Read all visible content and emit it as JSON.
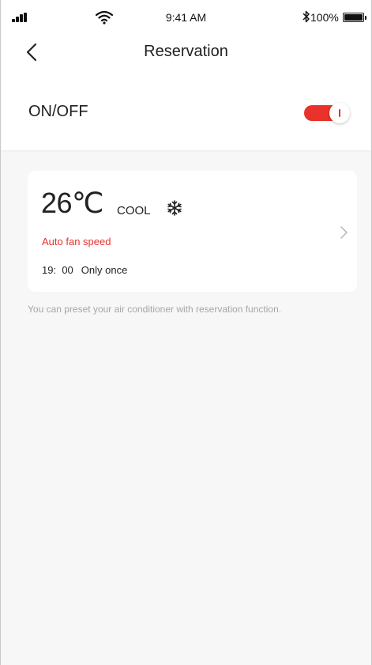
{
  "status_bar": {
    "time": "9:41 AM",
    "battery": "100%",
    "icons": [
      "signal-icon",
      "wifi-icon",
      "bluetooth-icon",
      "battery-icon"
    ]
  },
  "nav": {
    "title": "Reservation",
    "back_icon": "chevron-left-icon"
  },
  "power": {
    "label": "ON/OFF",
    "enabled": true
  },
  "reservation": {
    "temperature": "26℃",
    "mode": "COOL",
    "mode_icon": "snowflake-icon",
    "fan_speed": "Auto fan speed",
    "hour": "19",
    "separator": ":",
    "minute": "00",
    "repeat": "Only once"
  },
  "hint": "You can preset your air conditioner with reservation function.",
  "colors": {
    "accent": "#e8322b",
    "background": "#f7f7f7",
    "card": "#ffffff",
    "hint_text": "#a6a6a6"
  }
}
